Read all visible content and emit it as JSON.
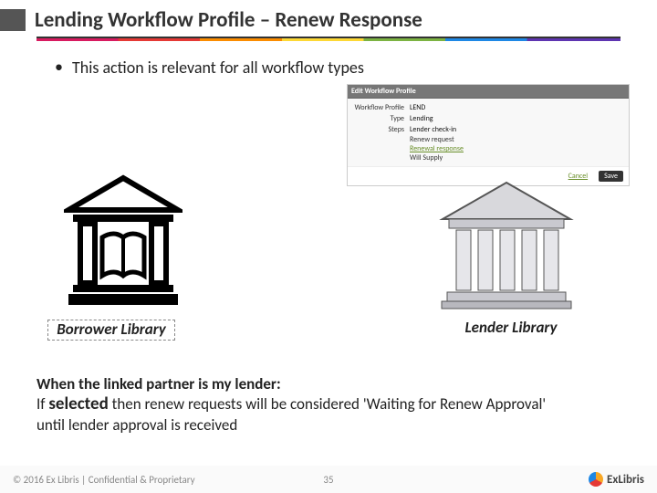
{
  "title": "Lending Workflow Profile – Renew Response",
  "bullet": "This action is relevant for all workflow types",
  "profile": {
    "header": "Edit Workflow Profile",
    "name_label": "Workflow Profile",
    "name_value": "LEND",
    "type_label": "Type",
    "type_value": "Lending",
    "steps_label": "Steps",
    "steps": [
      "Lender check-in",
      "Renew request",
      "Renewal response",
      "Will Supply"
    ],
    "selected_step_index": 2,
    "cancel": "Cancel",
    "save": "Save"
  },
  "captions": {
    "borrower": "Borrower Library",
    "lender": "Lender Library"
  },
  "explain": {
    "l1": "When the linked partner is my lender:",
    "l2a": "If ",
    "l2b": "selected",
    "l2c": " then renew requests will be considered 'Waiting for Renew Approval'",
    "l3": "until lender approval is received"
  },
  "footer": {
    "copyright": "© 2016 Ex Libris | Confidential & Proprietary",
    "slide_no": "35",
    "brand": "ExLibris"
  }
}
